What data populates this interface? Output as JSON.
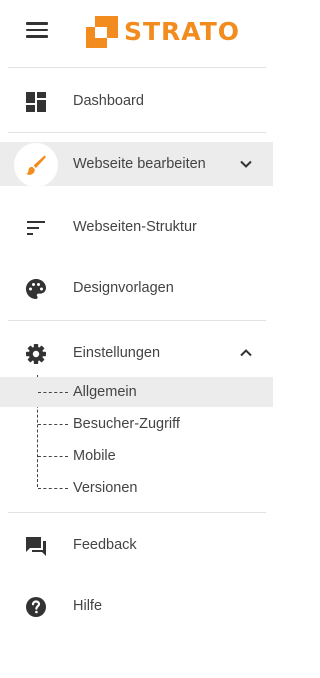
{
  "brand": {
    "name": "STRATO",
    "color": "#f28c1e"
  },
  "colors": {
    "icon": "#333333",
    "active_bg": "#ececec",
    "accent": "#f28c1e"
  },
  "nav": {
    "dashboard": {
      "label": "Dashboard",
      "icon": "dashboard-icon"
    },
    "edit_site": {
      "label": "Webseite bearbeiten",
      "icon": "brush-icon",
      "expanded": false
    },
    "structure": {
      "label": "Webseiten-Struktur",
      "icon": "sort-lines-icon"
    },
    "templates": {
      "label": "Designvorlagen",
      "icon": "palette-icon"
    },
    "settings": {
      "label": "Einstellungen",
      "icon": "gear-icon",
      "expanded": true,
      "children": [
        {
          "label": "Allgemein",
          "selected": true
        },
        {
          "label": "Besucher-Zugriff",
          "selected": false
        },
        {
          "label": "Mobile",
          "selected": false
        },
        {
          "label": "Versionen",
          "selected": false
        }
      ]
    },
    "feedback": {
      "label": "Feedback",
      "icon": "feedback-icon"
    },
    "help": {
      "label": "Hilfe",
      "icon": "help-icon"
    }
  }
}
